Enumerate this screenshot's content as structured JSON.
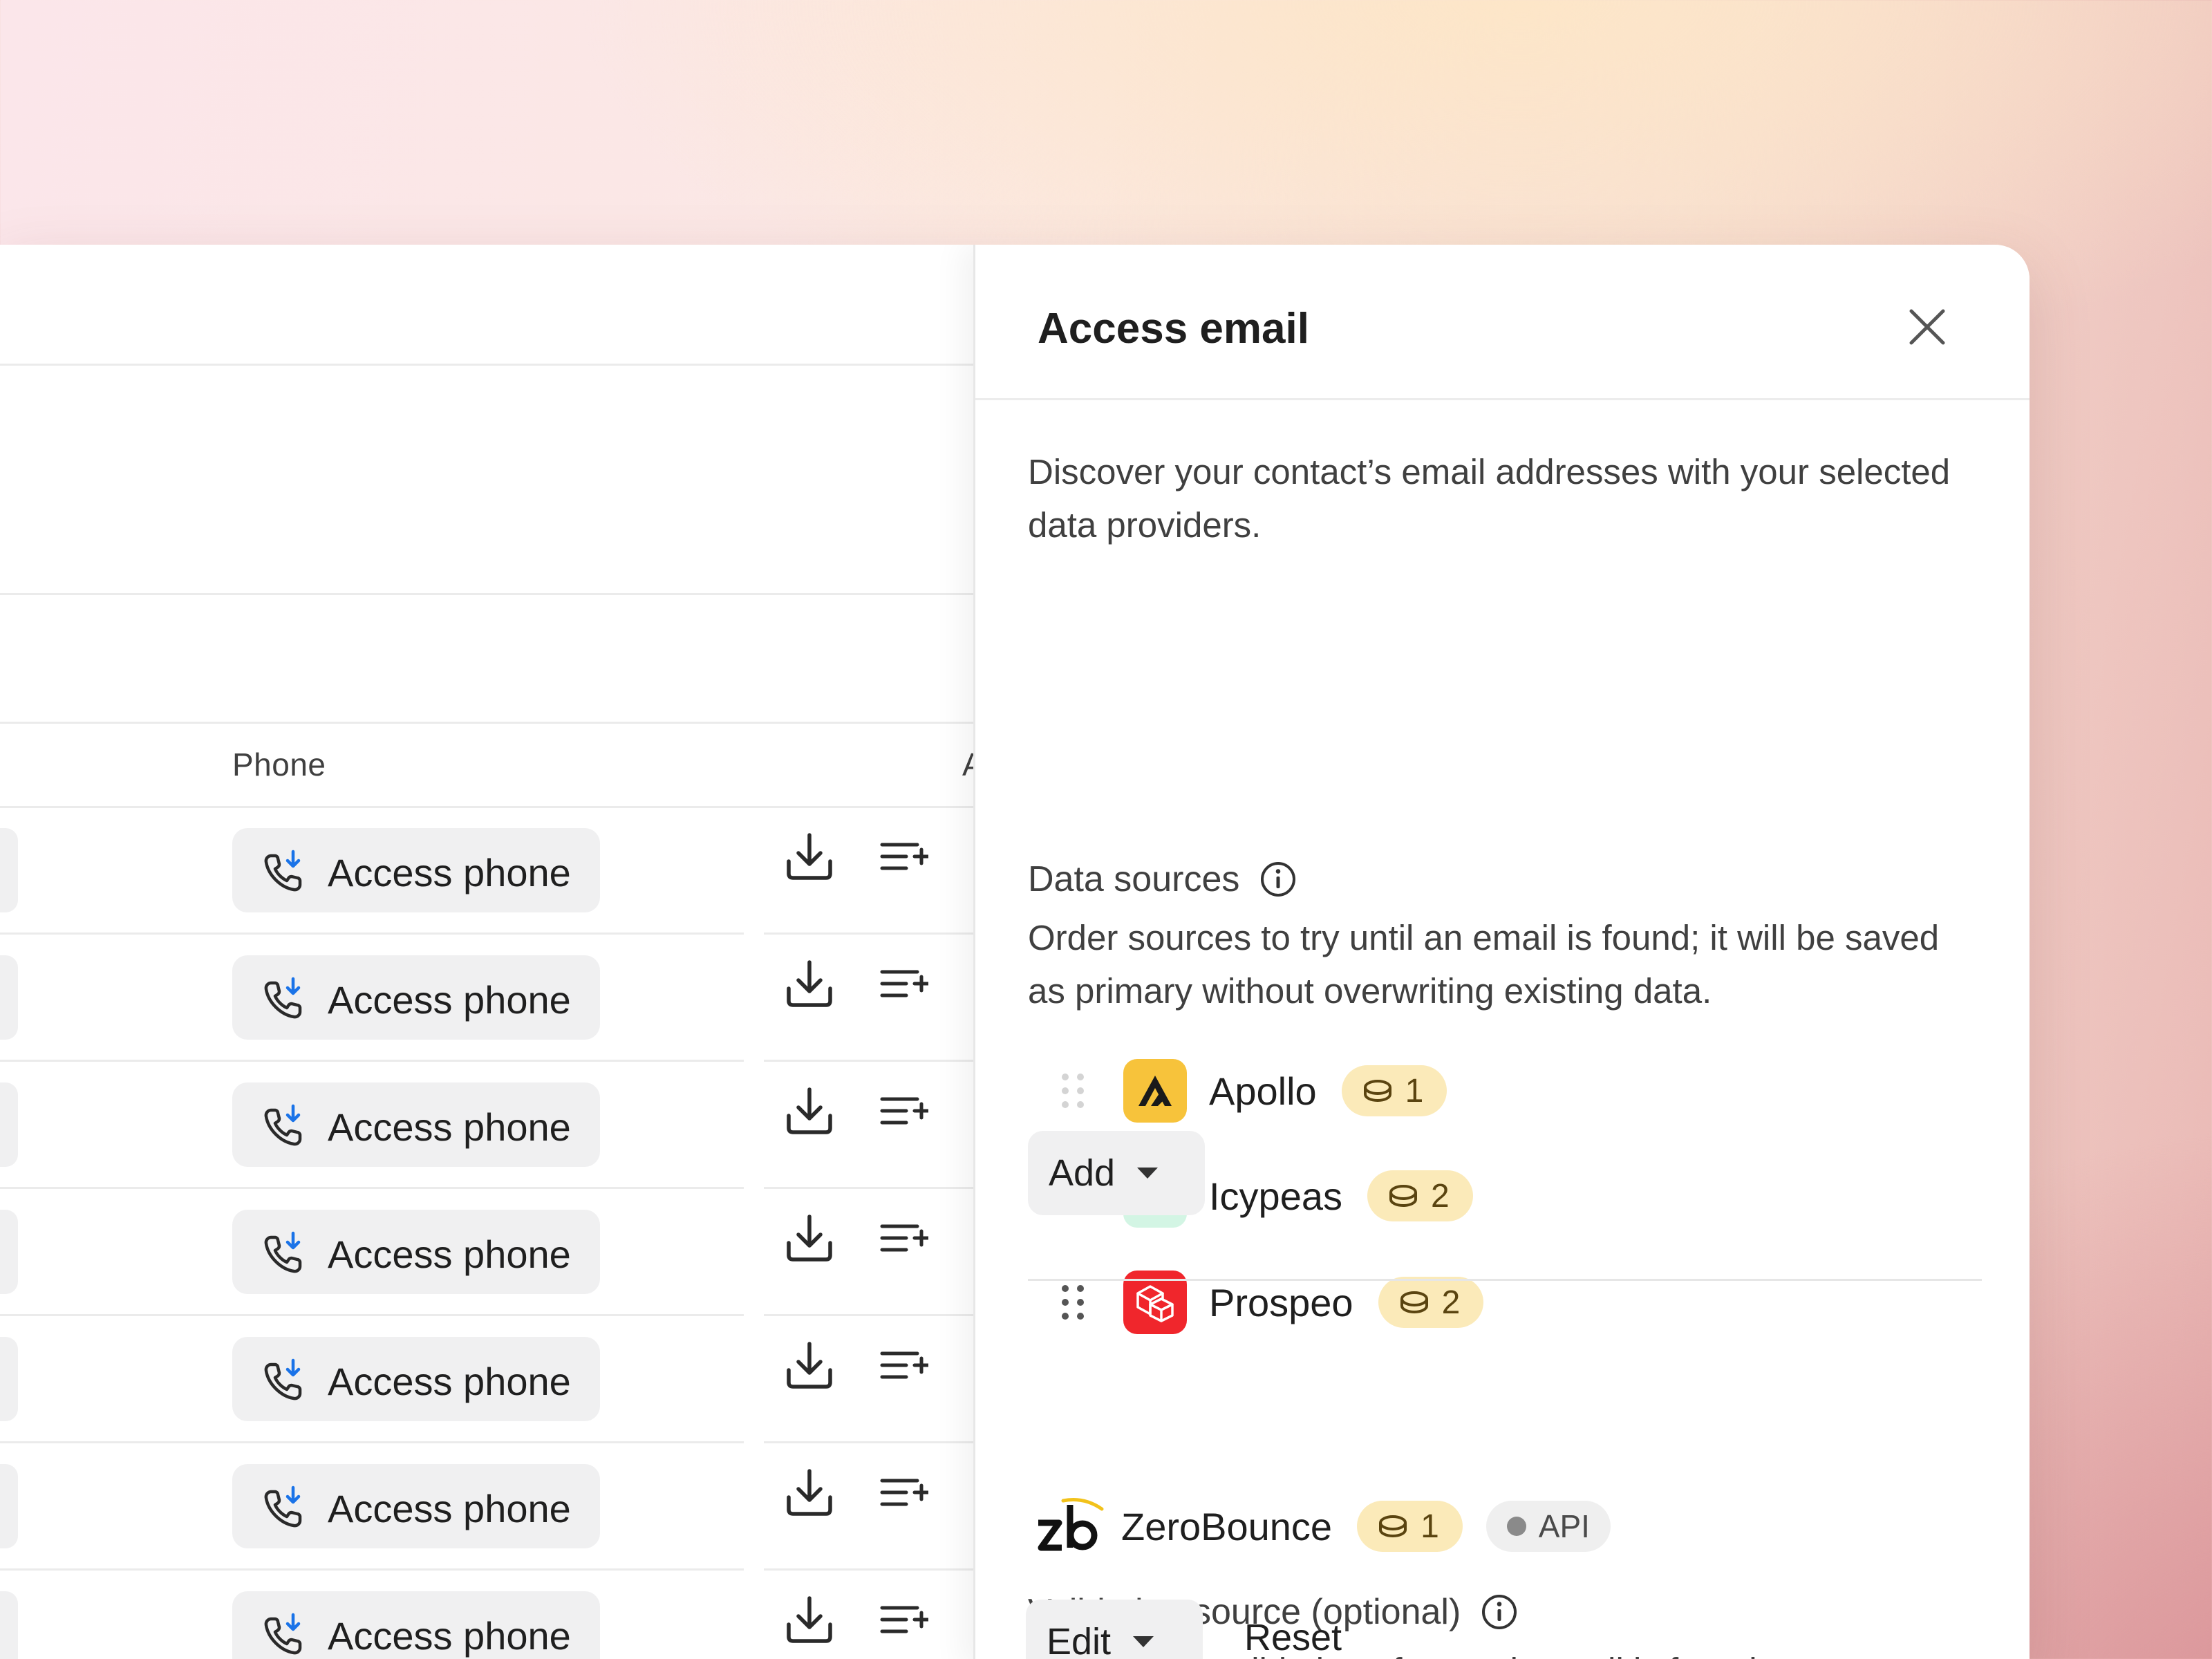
{
  "table": {
    "column_header": "Phone",
    "column_header_next": "A",
    "row_action_label": "Access phone",
    "row_count": 7
  },
  "panel": {
    "title": "Access email",
    "description": "Discover your contact’s email addresses with your selected data providers.",
    "data_sources": {
      "title": "Data sources",
      "description": "Order sources to try until an email is found; it will be saved as primary without overwriting existing data.",
      "items": [
        {
          "name": "Apollo",
          "credits": "1",
          "logo_color": "#f7c33b"
        },
        {
          "name": "Icypeas",
          "credits": "2",
          "logo_color": "#d3f5e4"
        },
        {
          "name": "Prospeo",
          "credits": "2",
          "logo_color": "#f0262c"
        }
      ],
      "add_label": "Add"
    },
    "validation": {
      "title": "Validation source (optional)",
      "description": "Add instant validation after each email is found.",
      "provider": {
        "name": "ZeroBounce",
        "credits": "1",
        "badge": "API"
      },
      "edit_label": "Edit",
      "reset_label": "Reset"
    }
  },
  "colors": {
    "credit_badge_bg": "#fbeab9",
    "phone_icon_accent": "#1a73e8",
    "panel_bg": "#ffffff"
  }
}
